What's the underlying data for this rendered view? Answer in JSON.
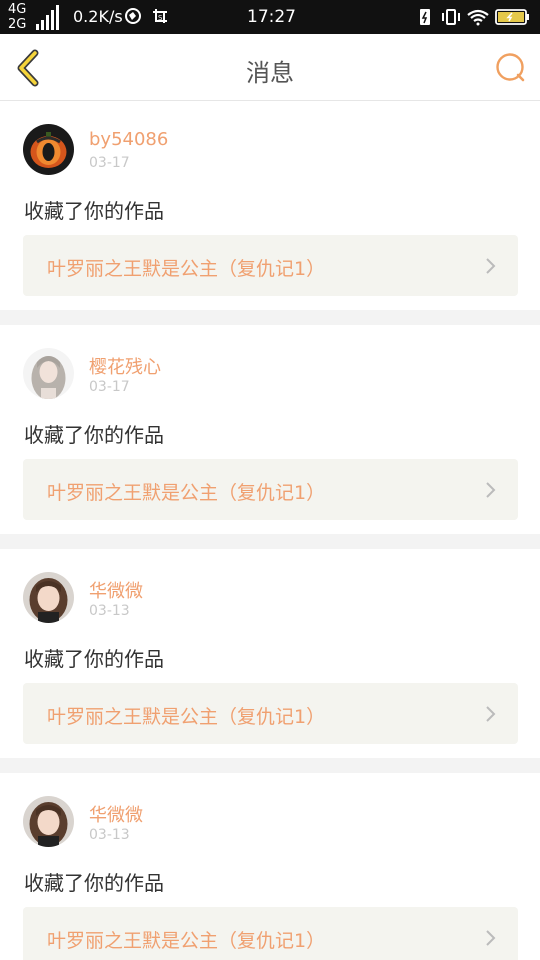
{
  "status_bar": {
    "net_top": "4G",
    "net_bottom": "2G",
    "speed": "0.2K/s",
    "time": "17:27"
  },
  "header": {
    "title": "消息",
    "accent_color": "#f0a060"
  },
  "messages": [
    {
      "username": "by54086",
      "date": "03-17",
      "action": "收藏了你的作品",
      "work_title": "叶罗丽之王默是公主（复仇记1）"
    },
    {
      "username": "樱花残心",
      "date": "03-17",
      "action": "收藏了你的作品",
      "work_title": "叶罗丽之王默是公主（复仇记1）"
    },
    {
      "username": "华微微",
      "date": "03-13",
      "action": "收藏了你的作品",
      "work_title": "叶罗丽之王默是公主（复仇记1）"
    },
    {
      "username": "华微微",
      "date": "03-13",
      "action": "收藏了你的作品",
      "work_title": "叶罗丽之王默是公主（复仇记1）"
    }
  ]
}
